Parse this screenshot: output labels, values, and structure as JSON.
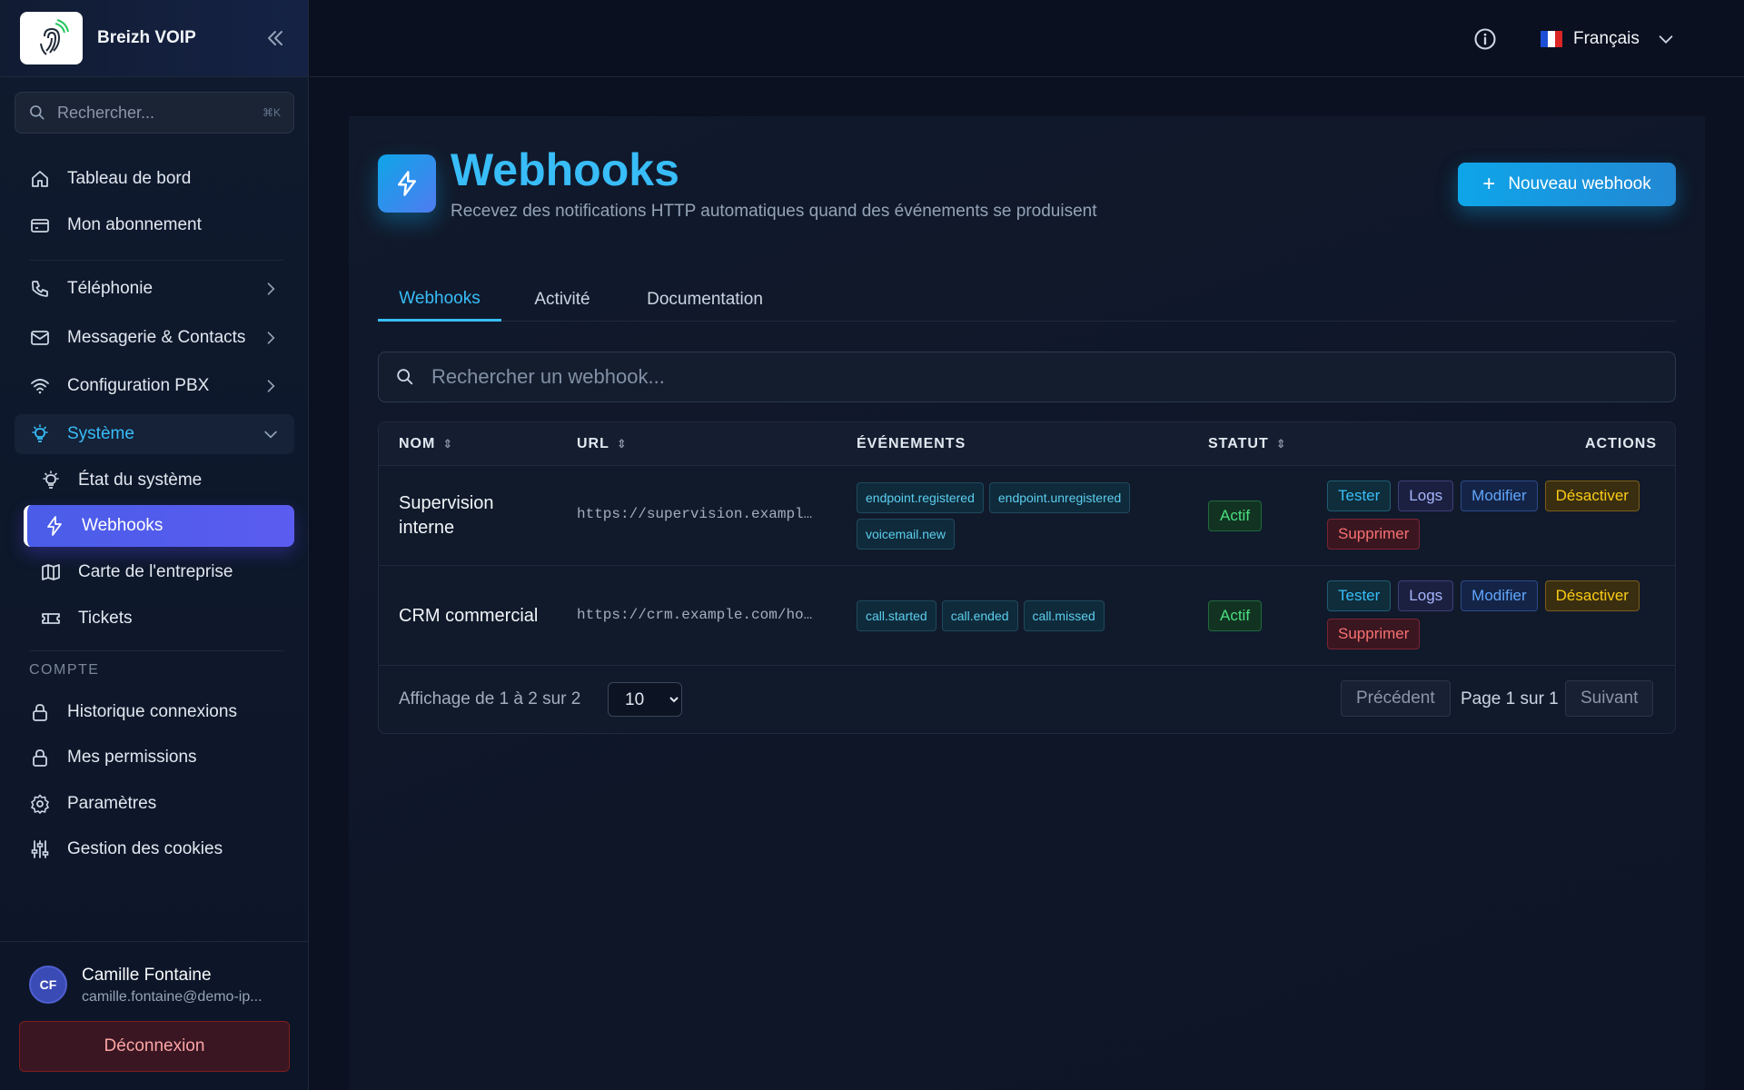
{
  "brand": {
    "name": "Breizh VOIP"
  },
  "sidebar": {
    "search_placeholder": "Rechercher...",
    "search_shortcut": "⌘K",
    "items": [
      {
        "label": "Tableau de bord",
        "icon": "home-icon"
      },
      {
        "label": "Mon abonnement",
        "icon": "card-icon"
      },
      {
        "label": "Téléphonie",
        "icon": "phone-icon"
      },
      {
        "label": "Messagerie & Contacts",
        "icon": "mail-icon"
      },
      {
        "label": "Configuration PBX",
        "icon": "wifi-icon"
      },
      {
        "label": "Système",
        "icon": "bulb-icon"
      },
      {
        "label": "État du système",
        "icon": "bulb-icon"
      },
      {
        "label": "Webhooks",
        "icon": "bolt-icon"
      },
      {
        "label": "Carte de l'entreprise",
        "icon": "map-icon"
      },
      {
        "label": "Tickets",
        "icon": "ticket-icon"
      },
      {
        "label": "Historique connexions",
        "icon": "lock-icon"
      },
      {
        "label": "Mes permissions",
        "icon": "lock-icon"
      },
      {
        "label": "Paramètres",
        "icon": "gear-icon"
      },
      {
        "label": "Gestion des cookies",
        "icon": "sliders-icon"
      }
    ],
    "section_account": "COMPTE"
  },
  "user": {
    "initials": "CF",
    "name": "Camille Fontaine",
    "email": "camille.fontaine@demo-ip...",
    "logout_label": "Déconnexion"
  },
  "topbar": {
    "language": "Français"
  },
  "page": {
    "title": "Webhooks",
    "subtitle": "Recevez des notifications HTTP automatiques quand des événements se produisent",
    "new_button": "Nouveau webhook",
    "tabs": [
      {
        "label": "Webhooks"
      },
      {
        "label": "Activité"
      },
      {
        "label": "Documentation"
      }
    ],
    "search_placeholder": "Rechercher un webhook..."
  },
  "table": {
    "columns": {
      "name": "NOM",
      "url": "URL",
      "events": "ÉVÉNEMENTS",
      "status": "STATUT",
      "actions": "ACTIONS"
    },
    "rows": [
      {
        "name_line1": "Supervision",
        "name_line2": "interne",
        "url": "https://supervision.exampl…",
        "events": [
          "endpoint.registered",
          "endpoint.unregistered",
          "voicemail.new"
        ],
        "status": "Actif"
      },
      {
        "name_line1": "CRM commercial",
        "name_line2": "",
        "url": "https://crm.example.com/ho…",
        "events": [
          "call.started",
          "call.ended",
          "call.missed"
        ],
        "status": "Actif"
      }
    ],
    "action_labels": {
      "test": "Tester",
      "logs": "Logs",
      "edit": "Modifier",
      "disable": "Désactiver",
      "delete": "Supprimer"
    },
    "footer": {
      "showing": "Affichage de 1 à 2 sur 2",
      "page_size": "10",
      "prev": "Précédent",
      "page_info": "Page 1 sur 1",
      "next": "Suivant"
    }
  },
  "colors": {
    "accent": "#38bdf8",
    "active_nav": "#4f5de8",
    "status_active": "#4ade80"
  }
}
